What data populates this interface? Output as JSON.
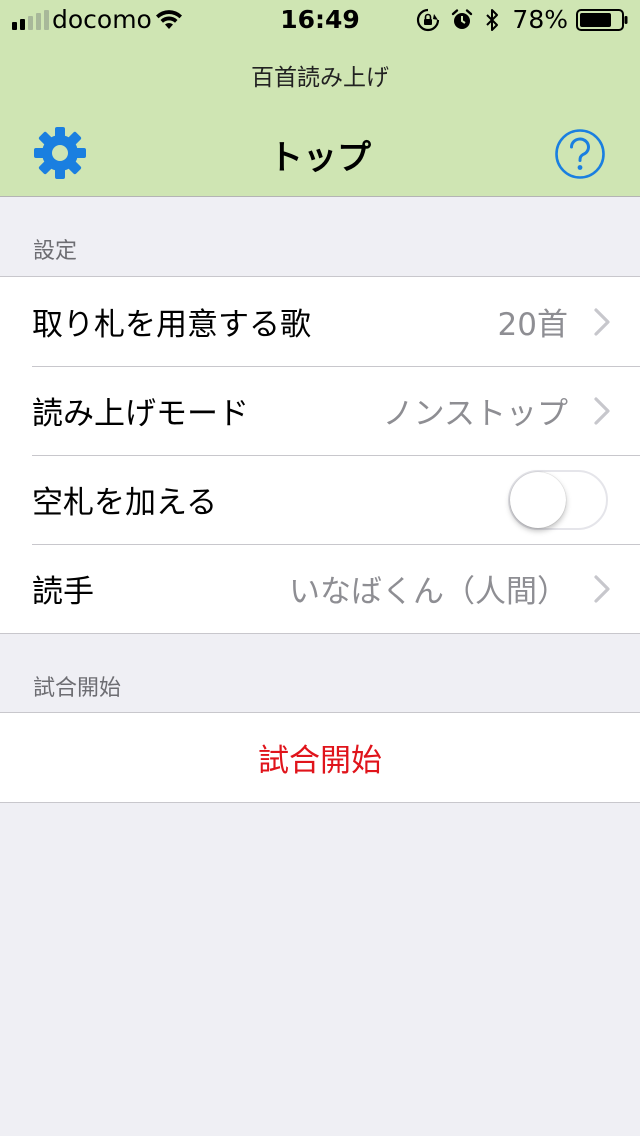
{
  "status_bar": {
    "carrier": "docomo",
    "time": "16:49",
    "battery_percent": "78%",
    "signal_bars": 5,
    "signal_active_bars": 2,
    "battery_level": 0.78,
    "icons": [
      "orientation-lock-icon",
      "alarm-icon",
      "bluetooth-icon"
    ]
  },
  "header": {
    "app_title": "百首読み上げ",
    "nav_title": "トップ",
    "left_button_icon": "gear-icon",
    "right_button_icon": "help-icon",
    "background_color": "#cfe5b3",
    "icon_color": "#1a7fe0"
  },
  "settings_section": {
    "header": "設定",
    "rows": [
      {
        "label": "取り札を用意する歌",
        "value": "20首",
        "accessory": "chevron"
      },
      {
        "label": "読み上げモード",
        "value": "ノンストップ",
        "accessory": "chevron"
      },
      {
        "label": "空札を加える",
        "accessory": "toggle",
        "toggle_on": false
      },
      {
        "label": "読手",
        "value": "いなばくん（人間）",
        "accessory": "chevron"
      }
    ]
  },
  "match_section": {
    "header": "試合開始",
    "button_label": "試合開始",
    "button_color": "#e0141b"
  }
}
